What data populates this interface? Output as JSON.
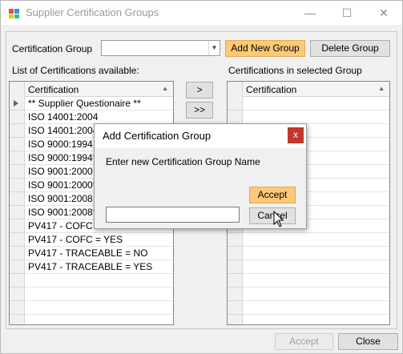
{
  "window": {
    "title": "Supplier Certification Groups",
    "minimize": "—",
    "maximize": "☐",
    "close": "✕"
  },
  "group": {
    "label": "Certification Group",
    "combo_value": "",
    "add_button": "Add New Group",
    "delete_button": "Delete Group"
  },
  "available": {
    "label": "List of Certifications available:",
    "column": "Certification",
    "rows": [
      "** Supplier Questionaire **",
      "ISO 14001:2004",
      "ISO 14001:2004*",
      "ISO 9000:1994",
      "ISO 9000:1994*",
      "ISO 9001:2000",
      "ISO 9001:2000*",
      "ISO 9001:2008",
      "ISO 9001:2008*",
      "PV417 - COFC = NO",
      "PV417 - COFC = YES",
      "PV417 - TRACEABLE = NO",
      "PV417 - TRACEABLE = YES"
    ]
  },
  "transfer": {
    "move_one": ">",
    "move_all": ">>"
  },
  "selected": {
    "label": "Certifications in selected Group",
    "column": "Certification"
  },
  "footer": {
    "accept": "Accept",
    "close": "Close"
  },
  "dialog": {
    "title": "Add Certification Group",
    "close": "x",
    "prompt": "Enter new Certification Group Name",
    "input_value": "",
    "accept": "Accept",
    "cancel": "Cancel"
  }
}
